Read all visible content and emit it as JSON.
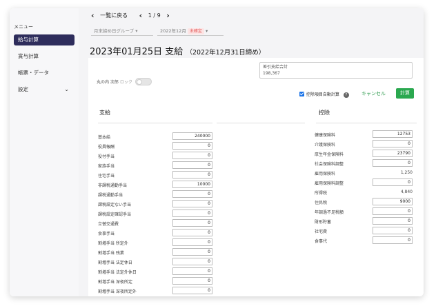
{
  "sidebar": {
    "title": "メニュー",
    "items": [
      {
        "label": "給与計算",
        "active": true
      },
      {
        "label": "賞与計算",
        "active": false
      },
      {
        "label": "帳票・データ",
        "active": false
      },
      {
        "label": "設定",
        "active": false,
        "chevron": "⌄"
      }
    ]
  },
  "nav": {
    "back_label": "一覧に戻る",
    "page_indicator": "1 / 9"
  },
  "filters": {
    "group_label": "月末締め日グループ",
    "period_label": "2022年12月",
    "status_badge": "未確定"
  },
  "page": {
    "title": "2023年01月25日 支給",
    "subtitle": "（2022年12月31日締め）"
  },
  "toggle": {
    "label": "丸の内 次郎",
    "lock_label": "ロック"
  },
  "net_pay": {
    "label": "差引支給合計",
    "value": "198,367"
  },
  "actions": {
    "auto_calc_label": "控除項目自動計算",
    "help_icon": "?",
    "cancel_label": "キャンセル",
    "calc_label": "計算"
  },
  "payments": {
    "heading": "支給",
    "rows": [
      {
        "label": "基本給",
        "value": "240000"
      },
      {
        "label": "役員報酬",
        "value": "0"
      },
      {
        "label": "役付手当",
        "value": "0"
      },
      {
        "label": "家族手当",
        "value": "0"
      },
      {
        "label": "住宅手当",
        "value": "0"
      },
      {
        "label": "非課税通勤手当",
        "value": "10000"
      },
      {
        "label": "課税通勤手当",
        "value": "0"
      },
      {
        "label": "課税設定ない手当",
        "value": "0"
      },
      {
        "label": "課税設定確認手当",
        "value": "0"
      },
      {
        "label": "立替交通費",
        "value": "0"
      },
      {
        "label": "食事手当",
        "value": "0"
      },
      {
        "label": "割増手当 所定外",
        "value": "0"
      },
      {
        "label": "割増手当 残業",
        "value": "0"
      },
      {
        "label": "割増手当 法定休日",
        "value": "0"
      },
      {
        "label": "割増手当 法定外休日",
        "value": "0"
      },
      {
        "label": "割増手当 深夜所定",
        "value": "0"
      },
      {
        "label": "割増手当 深夜所定外",
        "value": "0"
      }
    ]
  },
  "deductions": {
    "heading": "控除",
    "rows": [
      {
        "label": "健康保険料",
        "value": "12753",
        "type": "input"
      },
      {
        "label": "介護保険料",
        "value": "0",
        "type": "input"
      },
      {
        "label": "厚生年金保険料",
        "value": "23790",
        "type": "input"
      },
      {
        "label": "社会保険料調整",
        "value": "0",
        "type": "input"
      },
      {
        "label": "雇用保険料",
        "value": "1,250",
        "type": "static"
      },
      {
        "label": "雇用保険料調整",
        "value": "0",
        "type": "input"
      },
      {
        "label": "所得税",
        "value": "4,840",
        "type": "static"
      },
      {
        "label": "住民税",
        "value": "9000",
        "type": "input"
      },
      {
        "label": "年調過不足税額",
        "value": "0",
        "type": "input"
      },
      {
        "label": "財形貯蓄",
        "value": "0",
        "type": "input"
      },
      {
        "label": "社宅費",
        "value": "0",
        "type": "input"
      },
      {
        "label": "食事代",
        "value": "0",
        "type": "input"
      }
    ]
  }
}
